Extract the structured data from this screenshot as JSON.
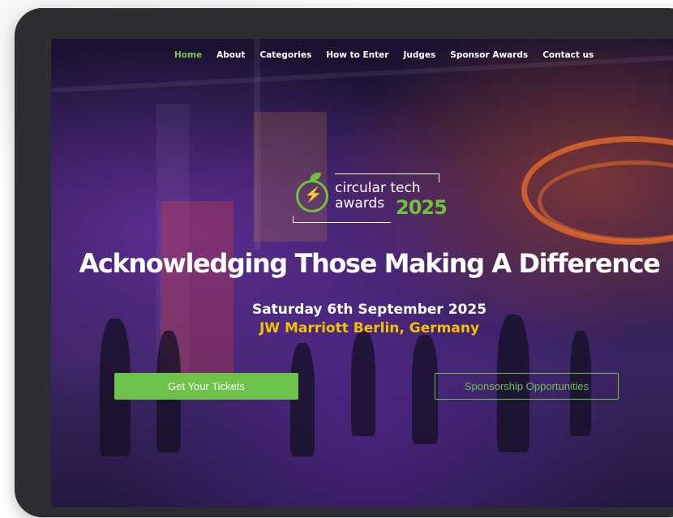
{
  "nav": {
    "items": [
      {
        "label": "Home",
        "active": true
      },
      {
        "label": "About",
        "active": false
      },
      {
        "label": "Categories",
        "active": false
      },
      {
        "label": "How to Enter",
        "active": false
      },
      {
        "label": "Judges",
        "active": false
      },
      {
        "label": "Sponsor Awards",
        "active": false
      },
      {
        "label": "Contact us",
        "active": false
      }
    ]
  },
  "logo": {
    "line1": "circular tech",
    "line2": "awards",
    "year": "2025"
  },
  "hero": {
    "headline": "Acknowledging Those Making A Difference",
    "date": "Saturday 6th September 2025",
    "venue": "JW Marriott Berlin, Germany"
  },
  "buttons": {
    "tickets": "Get Your Tickets",
    "sponsorship": "Sponsorship Opportunities"
  },
  "colors": {
    "accent_green": "#6cc24a",
    "accent_yellow": "#f2c200",
    "nav_active": "#7cc84a"
  }
}
